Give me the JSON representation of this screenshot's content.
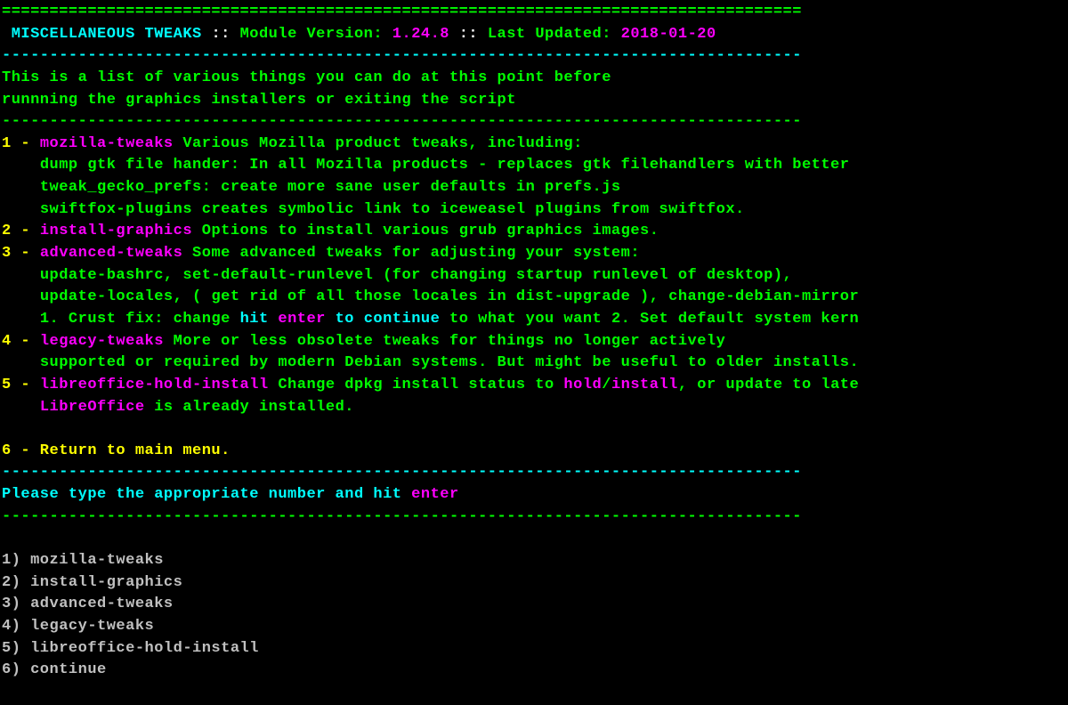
{
  "header": {
    "rule_top": "====================================================================================",
    "title": "MISCELLANEOUS TWEAKS",
    "sep1": " :: ",
    "version_label": "Module Version:",
    "version": " 1.24.8",
    "sep2": " :: ",
    "updated_label": "Last Updated:",
    "updated": " 2018-01-20",
    "dash_rule_a": "------------------------------------------------------------------------------------",
    "intro_line1": "This is a list of various things you can do at this point before",
    "intro_line2": "runnning the graphics installers or exiting the script",
    "dash_rule_b": "------------------------------------------------------------------------------------"
  },
  "items": [
    {
      "num": "1 - ",
      "name": "mozilla-tweaks",
      "desc": " Various Mozilla product tweaks, including:",
      "sub": [
        "    dump gtk file hander: In all Mozilla products - replaces gtk filehandlers with better",
        "    tweak_gecko_prefs: create more sane user defaults in prefs.js",
        "    swiftfox-plugins creates symbolic link to iceweasel plugins from swiftfox."
      ]
    },
    {
      "num": "2 - ",
      "name": "install-graphics",
      "desc": " Options to install various grub graphics images."
    },
    {
      "num": "3 - ",
      "name": "advanced-tweaks",
      "desc": " Some advanced tweaks for adjusting your system:",
      "sub": [
        "    update-bashrc, set-default-runlevel (for changing startup runlevel of desktop),",
        "    update-locales, ( get rid of all those locales in dist-upgrade ), change-debian-mirror"
      ]
    }
  ],
  "item3_tail": {
    "prefix": "    1. Crust fix: change ",
    "hit": "hit ",
    "enter": "enter",
    "to_continue": " to continue",
    "rest": " to what you want 2. Set default system kern"
  },
  "item4": {
    "num": "4 - ",
    "name": "legacy-tweaks",
    "desc": " More or less obsolete tweaks for things no longer actively",
    "sub": "    supported or required by modern Debian systems. But might be useful to older installs."
  },
  "item5": {
    "num": "5 - ",
    "name": "libreoffice-hold-install",
    "desc": " Change dpkg install status to ",
    "hold": "hold",
    "slash": "/",
    "install": "install",
    "rest": ", or update to late",
    "sub_a": "    ",
    "sub_name": "LibreOffice",
    "sub_b": " is already installed."
  },
  "item6": {
    "text": "6 - Return to main menu."
  },
  "footer": {
    "rule_c": "------------------------------------------------------------------------------------",
    "prompt_a": "Please type the appropriate number and hit ",
    "prompt_enter": "enter",
    "rule_d": "------------------------------------------------------------------------------------"
  },
  "menu": [
    "1) mozilla-tweaks",
    "2) install-graphics",
    "3) advanced-tweaks",
    "4) legacy-tweaks",
    "5) libreoffice-hold-install",
    "6) continue"
  ]
}
